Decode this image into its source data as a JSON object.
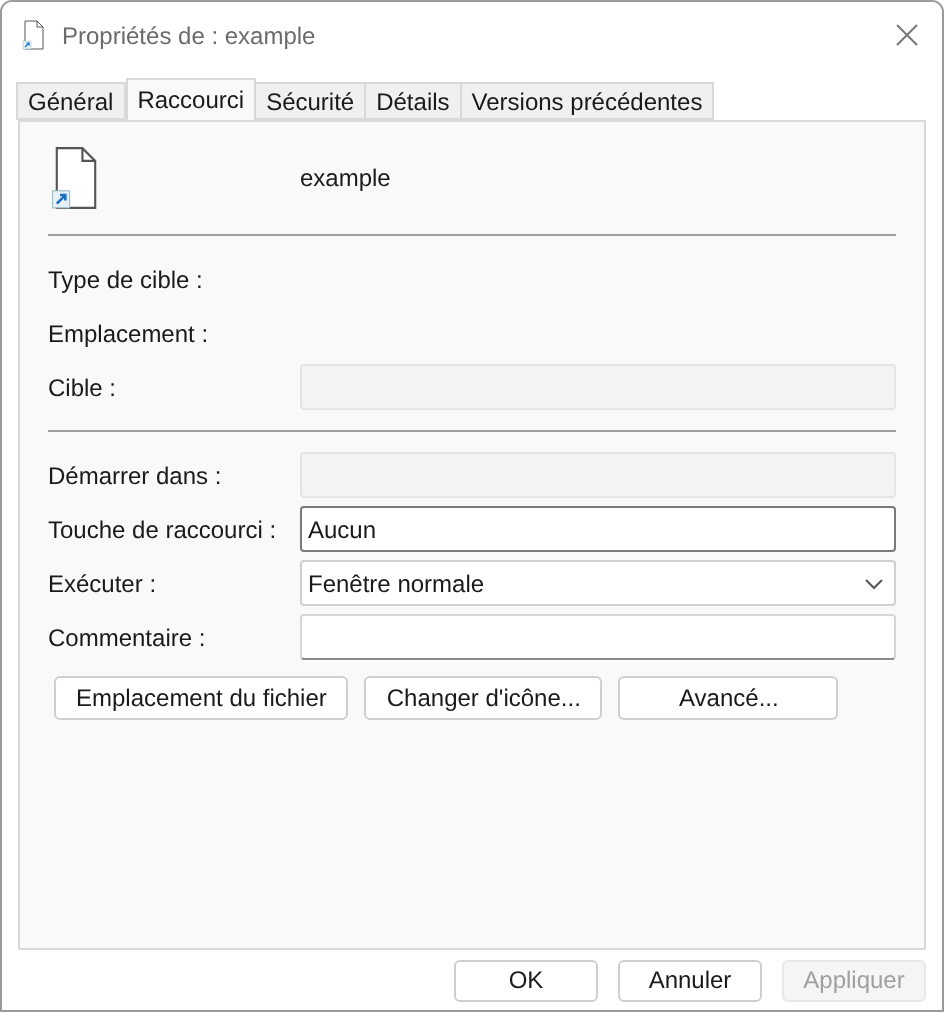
{
  "window": {
    "title": "Propriétés de : example"
  },
  "tabs": [
    {
      "label": "Général",
      "selected": false
    },
    {
      "label": "Raccourci",
      "selected": true
    },
    {
      "label": "Sécurité",
      "selected": false
    },
    {
      "label": "Détails",
      "selected": false
    },
    {
      "label": "Versions précédentes",
      "selected": false
    }
  ],
  "file_name": "example",
  "groups": [
    [
      {
        "kind": "label",
        "label": "Type de cible :"
      },
      {
        "kind": "label",
        "label": "Emplacement :"
      },
      {
        "kind": "field",
        "label": "Cible :",
        "disabled": true
      }
    ],
    [
      {
        "kind": "field",
        "label": "Démarrer dans :",
        "disabled": true
      },
      {
        "kind": "field",
        "label": "Touche de raccourci :",
        "disabled": false,
        "value": "Aucun",
        "focused": true
      },
      {
        "kind": "dropdown",
        "label": "Exécuter :",
        "value": "Fenêtre normale"
      },
      {
        "kind": "field",
        "label": "Commentaire :",
        "disabled": false
      }
    ]
  ],
  "actions": [
    {
      "label": "Emplacement du fichier"
    },
    {
      "label": "Changer d'icône..."
    },
    {
      "label": "Avancé..."
    }
  ],
  "buttons": [
    {
      "label": "OK",
      "disabled": false
    },
    {
      "label": "Annuler",
      "disabled": false
    },
    {
      "label": "Appliquer",
      "disabled": true
    }
  ]
}
